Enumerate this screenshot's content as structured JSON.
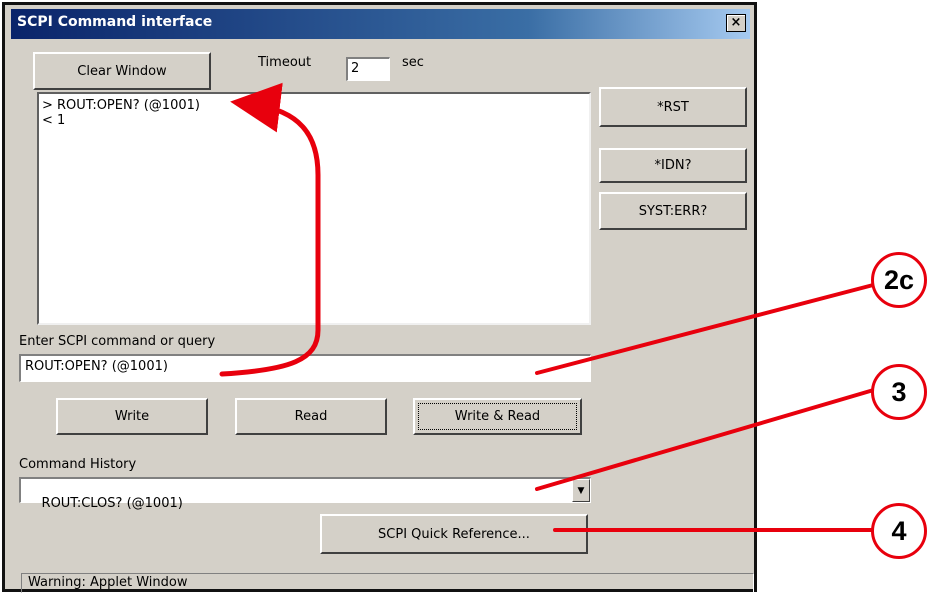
{
  "window": {
    "title": "SCPI Command interface",
    "close_glyph": "×"
  },
  "toolbar": {
    "clear_label": "Clear Window",
    "timeout_label": "Timeout",
    "timeout_value": "2",
    "timeout_unit": "sec"
  },
  "console": {
    "lines": [
      "> ROUT:OPEN? (@1001)",
      "< 1"
    ]
  },
  "side_buttons": {
    "rst": "*RST",
    "idn": "*IDN?",
    "syst_err": "SYST:ERR?"
  },
  "command": {
    "label": "Enter SCPI command or query",
    "value": "ROUT:OPEN? (@1001)"
  },
  "actions": {
    "write": "Write",
    "read": "Read",
    "write_read": "Write & Read"
  },
  "history": {
    "label": "Command History",
    "selected": "ROUT:CLOS? (@1001)"
  },
  "quick_ref": "SCPI Quick Reference...",
  "status_bar": "Warning: Applet Window",
  "callouts": {
    "c2c": "2c",
    "c3": "3",
    "c4": "4"
  },
  "colors": {
    "annotation": "#e8000d",
    "titlebar": "#0a246a",
    "dialog_face": "#d4d0c8"
  }
}
